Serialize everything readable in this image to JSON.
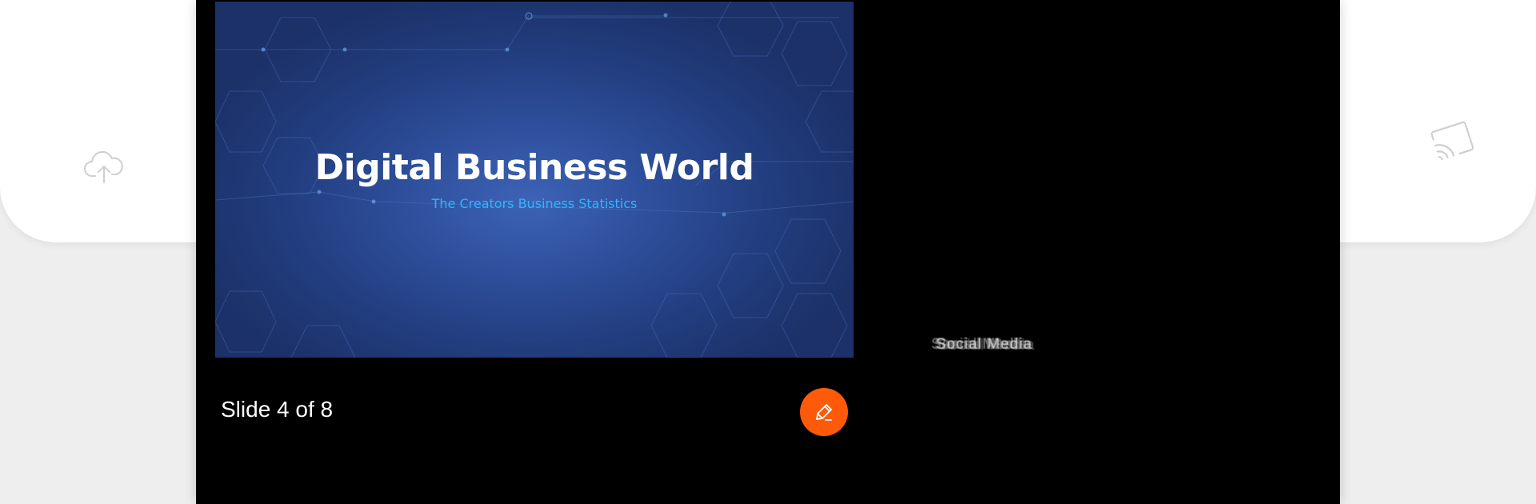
{
  "slide": {
    "title": "Digital Business World",
    "subtitle": "The Creators Business Statistics",
    "counter": "Slide 4 of 8"
  },
  "caption": {
    "text": "Social Media"
  },
  "icons": {
    "upload": "cloud-upload-icon",
    "cast": "cast-icon",
    "edit": "pencil-edit-icon"
  },
  "colors": {
    "accent": "#ff5a0a",
    "slide_subtitle": "#2fb6ff",
    "slide_bg": "#2e4f9c"
  }
}
